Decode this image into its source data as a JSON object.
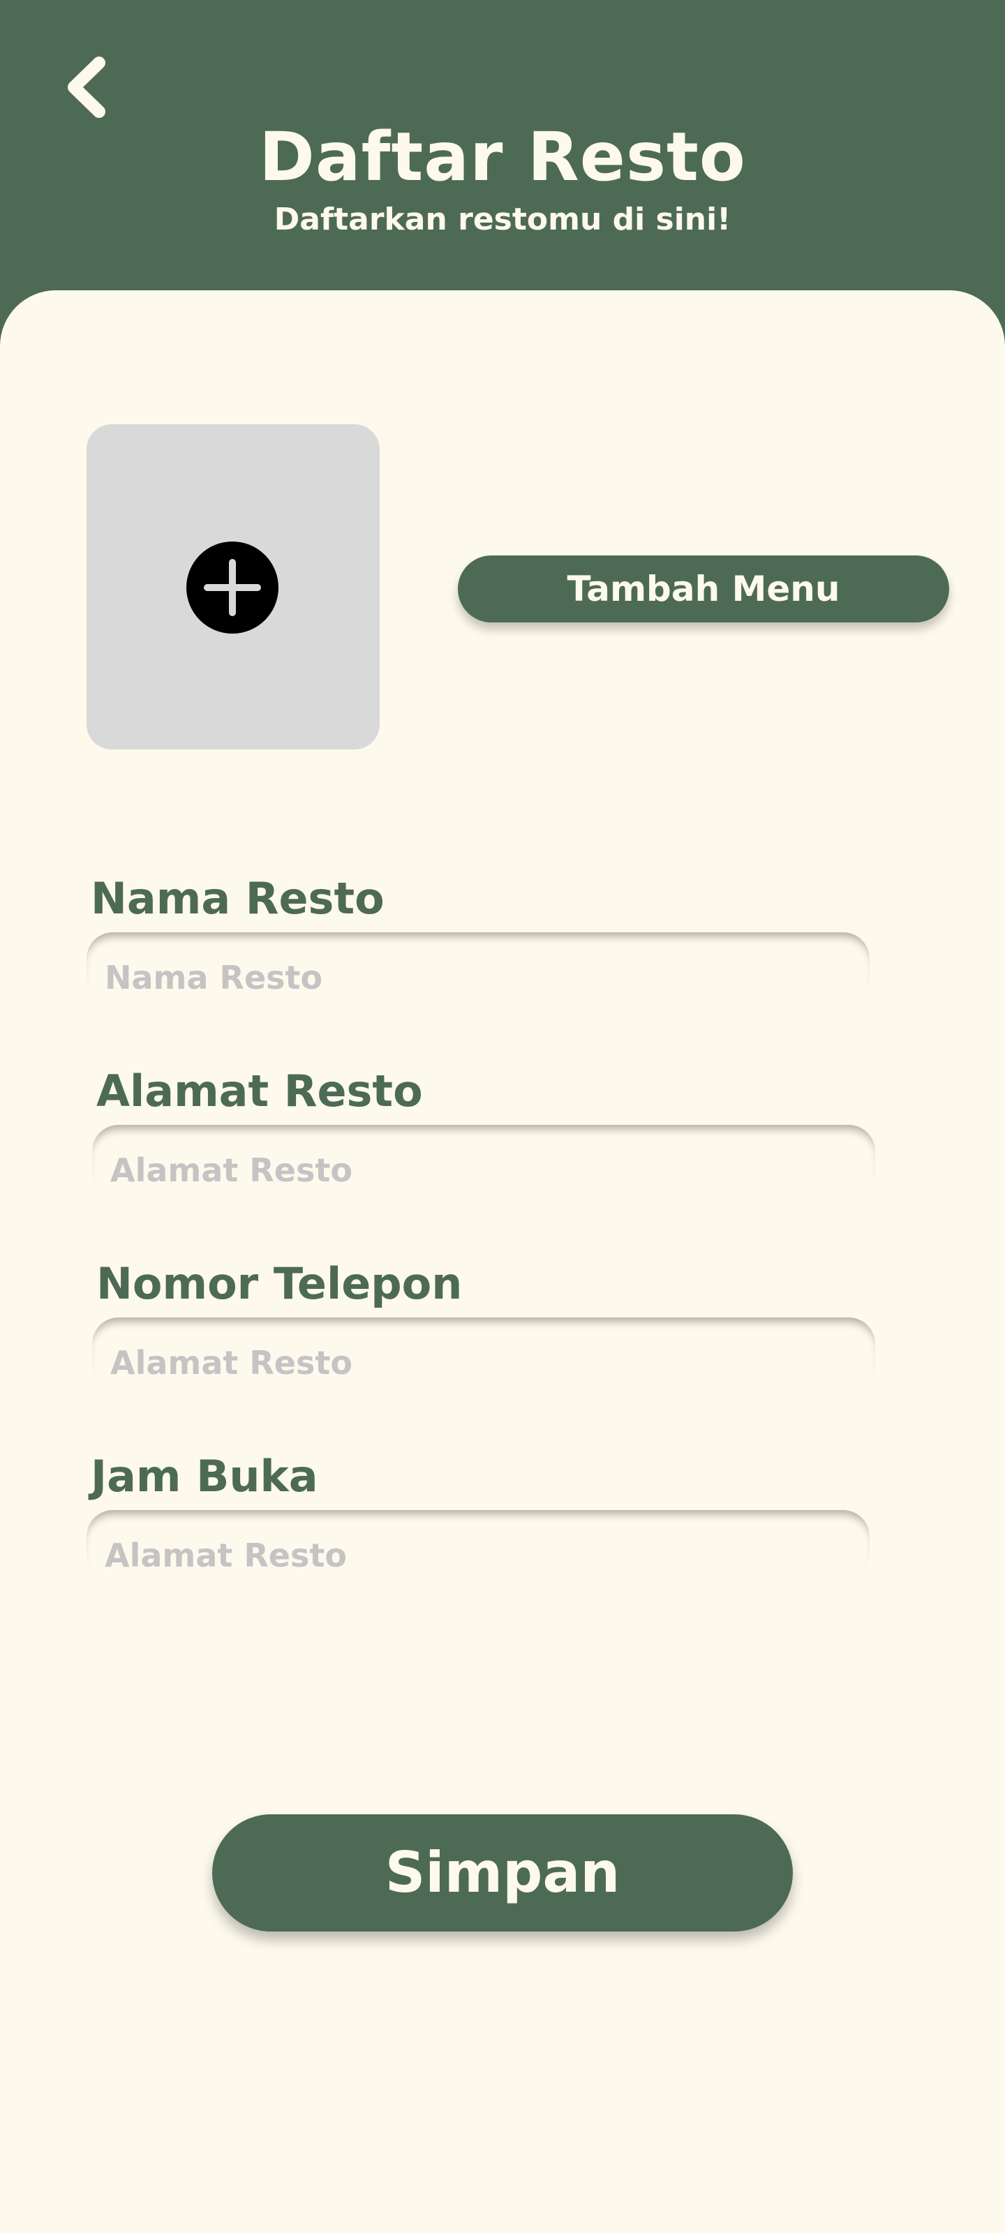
{
  "header": {
    "title": "Daftar Resto",
    "subtitle": "Daftarkan restomu di sini!",
    "back_icon": "chevron-left-icon"
  },
  "photo": {
    "icon": "plus-circle-icon"
  },
  "add_menu_label": "Tambah Menu",
  "fields": [
    {
      "label": "Nama Resto",
      "placeholder": "Nama Resto",
      "value": ""
    },
    {
      "label": "Alamat Resto",
      "placeholder": "Alamat Resto",
      "value": ""
    },
    {
      "label": "Nomor Telepon",
      "placeholder": "Alamat Resto",
      "value": ""
    },
    {
      "label": "Jam Buka",
      "placeholder": "Alamat Resto",
      "value": ""
    }
  ],
  "save_label": "Simpan",
  "colors": {
    "primary": "#4d6a55",
    "background": "#fdf9ec",
    "photo_placeholder": "#d9d9d9",
    "placeholder_text": "#c4c4c4"
  }
}
